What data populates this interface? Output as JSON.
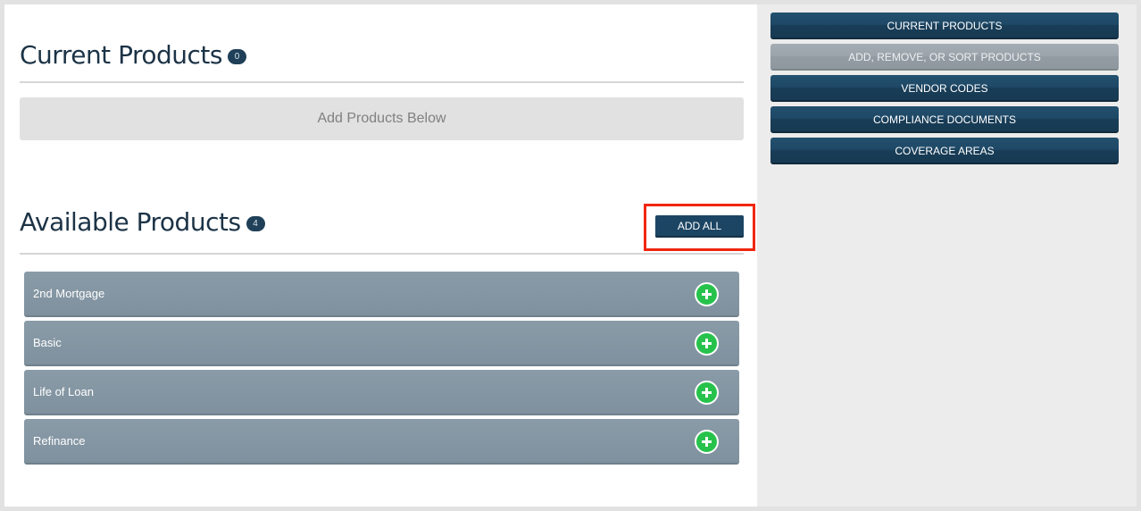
{
  "current": {
    "title": "Current Products",
    "count": "0",
    "empty_text": "Add Products Below"
  },
  "available": {
    "title": "Available Products",
    "count": "4",
    "add_all_label": "ADD ALL",
    "products": [
      {
        "name": "2nd Mortgage"
      },
      {
        "name": "Basic"
      },
      {
        "name": "Life of Loan"
      },
      {
        "name": "Refinance"
      }
    ]
  },
  "nav": {
    "items": [
      {
        "label": "CURRENT PRODUCTS"
      },
      {
        "label": "ADD, REMOVE, OR SORT PRODUCTS"
      },
      {
        "label": "VENDOR CODES"
      },
      {
        "label": "COMPLIANCE DOCUMENTS"
      },
      {
        "label": "COVERAGE AREAS"
      }
    ]
  },
  "icons": {
    "add": "plus-circle-icon"
  },
  "colors": {
    "brand_navy": "#1c4563",
    "add_green": "#27c24c",
    "highlight_red": "#f0260f",
    "row_gray": "#8a9ba8"
  }
}
